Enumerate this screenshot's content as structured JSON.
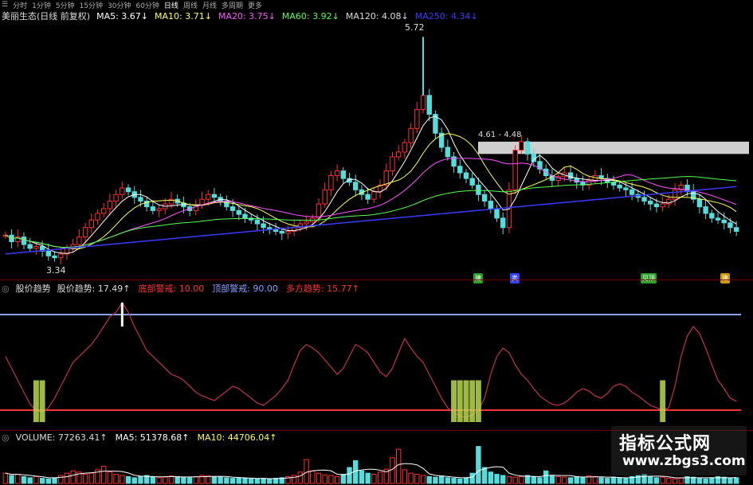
{
  "tabs": [
    "分时",
    "1分钟",
    "5分钟",
    "15分钟",
    "30分钟",
    "60分钟",
    "日线",
    "周线",
    "月线",
    "多周期",
    "更多"
  ],
  "active_tab": "日线",
  "main_legend": {
    "title": "美丽生态(日线 前复权)",
    "items": [
      {
        "label": "MA5: 3.67↓",
        "color": "#ffffff"
      },
      {
        "label": "MA10: 3.71↓",
        "color": "#ffff55"
      },
      {
        "label": "MA20: 3.75↓",
        "color": "#ff55ff"
      },
      {
        "label": "MA60: 3.92↓",
        "color": "#55ff55"
      },
      {
        "label": "MA120: 4.08↓",
        "color": "#dddddd"
      },
      {
        "label": "MA250: 4.34↓",
        "color": "#3a3aff"
      }
    ]
  },
  "annotations": {
    "high": "5.72",
    "low": "3.34",
    "range": "4.61 - 4.48"
  },
  "signal_marks": [
    {
      "label": "建",
      "color": "#2aa02a"
    },
    {
      "label": "卖",
      "color": "#3344ff"
    },
    {
      "label": "见顶",
      "color": "#2aa02a"
    },
    {
      "label": "建",
      "color": "#cc9900"
    }
  ],
  "ind_legend": {
    "name": "股价趋势",
    "items": [
      {
        "label": "股价趋势: 17.49↑",
        "color": "#dddddd"
      },
      {
        "label": "底部警戒: 10.00",
        "color": "#ff3333"
      },
      {
        "label": "顶部警戒: 90.00",
        "color": "#8aa0ff"
      },
      {
        "label": "多方趋势: 15.77↑",
        "color": "#ff3333"
      }
    ]
  },
  "vol_legend": {
    "items": [
      {
        "label": "VOLUME: 77263.41↑",
        "color": "#dddddd"
      },
      {
        "label": "MA5: 51378.68↑",
        "color": "#ffffff"
      },
      {
        "label": "MA10: 44706.04↑",
        "color": "#ffff55"
      }
    ]
  },
  "watermark": {
    "brand": "指标公式网",
    "url": "www.zbgs3.com"
  },
  "chart_data": [
    {
      "type": "candlestick",
      "name": "price",
      "xlim": [
        0,
        120
      ],
      "ylim": [
        3.2,
        5.9
      ],
      "close": [
        3.62,
        3.55,
        3.6,
        3.52,
        3.48,
        3.5,
        3.45,
        3.4,
        3.38,
        3.42,
        3.48,
        3.52,
        3.6,
        3.7,
        3.78,
        3.85,
        3.9,
        3.98,
        4.05,
        4.12,
        4.08,
        4.02,
        3.98,
        3.92,
        3.88,
        3.9,
        3.95,
        4.0,
        3.96,
        3.92,
        3.88,
        3.94,
        4.0,
        4.05,
        4.02,
        3.98,
        3.92,
        3.88,
        3.84,
        3.8,
        3.78,
        3.74,
        3.7,
        3.68,
        3.66,
        3.64,
        3.66,
        3.7,
        3.74,
        3.76,
        3.8,
        3.95,
        4.1,
        4.25,
        4.3,
        4.22,
        4.18,
        4.1,
        4.05,
        4.0,
        4.08,
        4.15,
        4.3,
        4.45,
        4.5,
        4.6,
        4.75,
        4.95,
        5.1,
        4.9,
        4.7,
        4.55,
        4.45,
        4.35,
        4.28,
        4.22,
        4.15,
        4.05,
        3.98,
        3.9,
        3.8,
        3.7,
        4.1,
        4.52,
        4.61,
        4.48,
        4.4,
        4.32,
        4.25,
        4.2,
        4.24,
        4.28,
        4.22,
        4.18,
        4.15,
        4.2,
        4.25,
        4.22,
        4.18,
        4.15,
        4.12,
        4.1,
        4.05,
        4.02,
        3.98,
        3.95,
        3.92,
        3.95,
        4.0,
        4.1,
        4.15,
        4.08,
        4.0,
        3.92,
        3.85,
        3.8,
        3.78,
        3.75,
        3.7,
        3.66
      ]
    },
    {
      "type": "line",
      "name": "股价趋势",
      "ylim": [
        0,
        100
      ],
      "guides": {
        "top": 90,
        "bottom": 10
      },
      "values": [
        55,
        45,
        35,
        25,
        15,
        10,
        8,
        12,
        20,
        30,
        40,
        50,
        55,
        60,
        65,
        72,
        80,
        88,
        92,
        100,
        92,
        80,
        70,
        60,
        55,
        50,
        45,
        40,
        38,
        35,
        30,
        25,
        22,
        20,
        18,
        22,
        26,
        30,
        28,
        24,
        20,
        16,
        14,
        18,
        22,
        28,
        35,
        48,
        60,
        65,
        62,
        58,
        52,
        46,
        40,
        45,
        55,
        65,
        62,
        58,
        50,
        42,
        38,
        45,
        58,
        70,
        62,
        55,
        50,
        40,
        30,
        20,
        12,
        8,
        5,
        4,
        6,
        10,
        20,
        40,
        55,
        62,
        58,
        48,
        40,
        35,
        28,
        22,
        18,
        15,
        14,
        16,
        20,
        25,
        28,
        26,
        22,
        20,
        24,
        30,
        32,
        30,
        25,
        22,
        18,
        14,
        12,
        10,
        12,
        30,
        55,
        72,
        80,
        74,
        62,
        48,
        35,
        28,
        20,
        17.49
      ]
    },
    {
      "type": "bar",
      "name": "VOLUME",
      "values": [
        18,
        14,
        16,
        12,
        10,
        12,
        9,
        8,
        10,
        14,
        18,
        22,
        20,
        16,
        18,
        24,
        30,
        20,
        16,
        14,
        12,
        10,
        12,
        14,
        12,
        10,
        11,
        13,
        12,
        11,
        10,
        12,
        14,
        13,
        12,
        11,
        10,
        9,
        10,
        9,
        8,
        8,
        9,
        8,
        9,
        10,
        12,
        14,
        20,
        42,
        22,
        18,
        15,
        14,
        12,
        16,
        28,
        40,
        22,
        18,
        16,
        20,
        25,
        45,
        60,
        24,
        18,
        16,
        14,
        12,
        11,
        13,
        10,
        9,
        8,
        10,
        18,
        65,
        28,
        20,
        16,
        14,
        12,
        11,
        12,
        14,
        12,
        10,
        22,
        14,
        12,
        11,
        10,
        12,
        11,
        13,
        12,
        10,
        9,
        11,
        10,
        9,
        12,
        14,
        16,
        12,
        10,
        11,
        9,
        8,
        10,
        12,
        11,
        9,
        8,
        10,
        12,
        11,
        9,
        10
      ]
    }
  ]
}
